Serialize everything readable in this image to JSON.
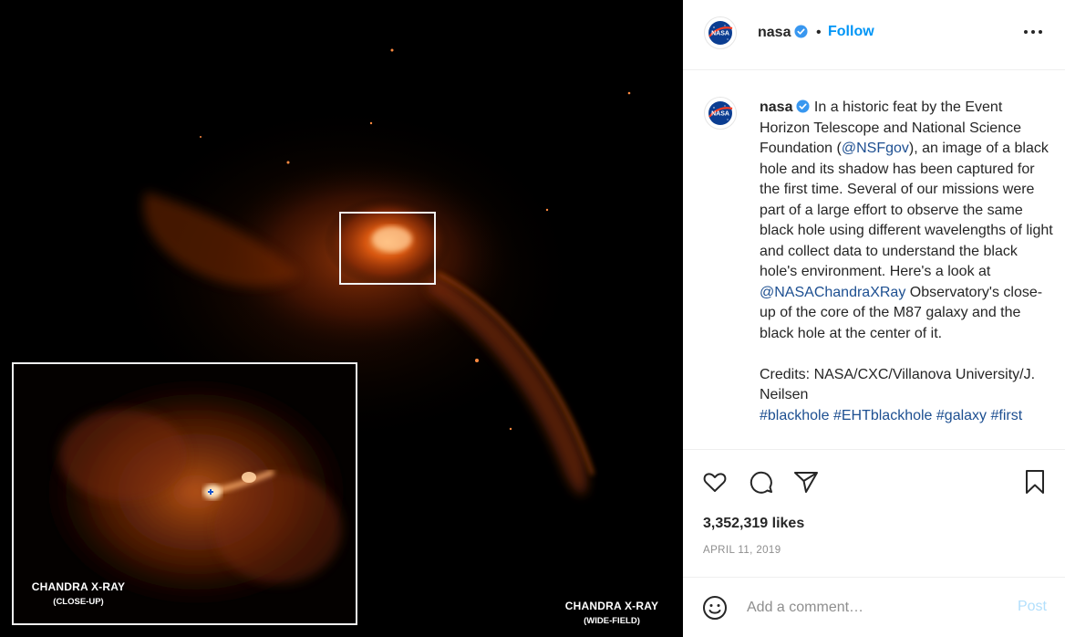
{
  "media": {
    "inset_caption_title": "CHANDRA X-RAY",
    "inset_caption_sub": "(CLOSE-UP)",
    "wide_caption_title": "CHANDRA X-RAY",
    "wide_caption_sub": "(WIDE-FIELD)"
  },
  "header": {
    "username": "nasa",
    "separator": "•",
    "follow_label": "Follow",
    "avatar_icon": "nasa-logo-icon",
    "verified_icon": "verified-badge-icon",
    "more_icon": "more-options-icon"
  },
  "caption": {
    "username": "nasa",
    "text_1": "In a historic feat by the Event Horizon Telescope and National Science Foundation (",
    "mention_1": "@NSFgov",
    "text_2": "), an image of a black hole and its shadow has been captured for the first time. Several of our missions were part of a large effort to observe the same black hole using different wavelengths of light and collect data to understand the black hole's environment. Here's a look at ",
    "mention_2": "@NASAChandraXRay",
    "text_3": " Observatory's close-up of the core of the M87 galaxy and the black hole at the center of it.",
    "credits": "Credits: NASA/CXC/Villanova University/J. Neilsen",
    "hashtags": [
      "#blackhole",
      "#EHTblackhole",
      "#galaxy",
      "#first"
    ]
  },
  "actions": {
    "like_icon": "heart-icon",
    "comment_icon": "comment-icon",
    "share_icon": "share-icon",
    "save_icon": "bookmark-icon",
    "likes": "3,352,319 likes",
    "date": "APRIL 11, 2019"
  },
  "comment": {
    "emoji_icon": "emoji-icon",
    "placeholder": "Add a comment…",
    "post_label": "Post"
  },
  "colors": {
    "accent": "#0095f6",
    "post_disabled": "#b2dffc",
    "link": "#00376b",
    "muted": "#8e8e8e"
  }
}
